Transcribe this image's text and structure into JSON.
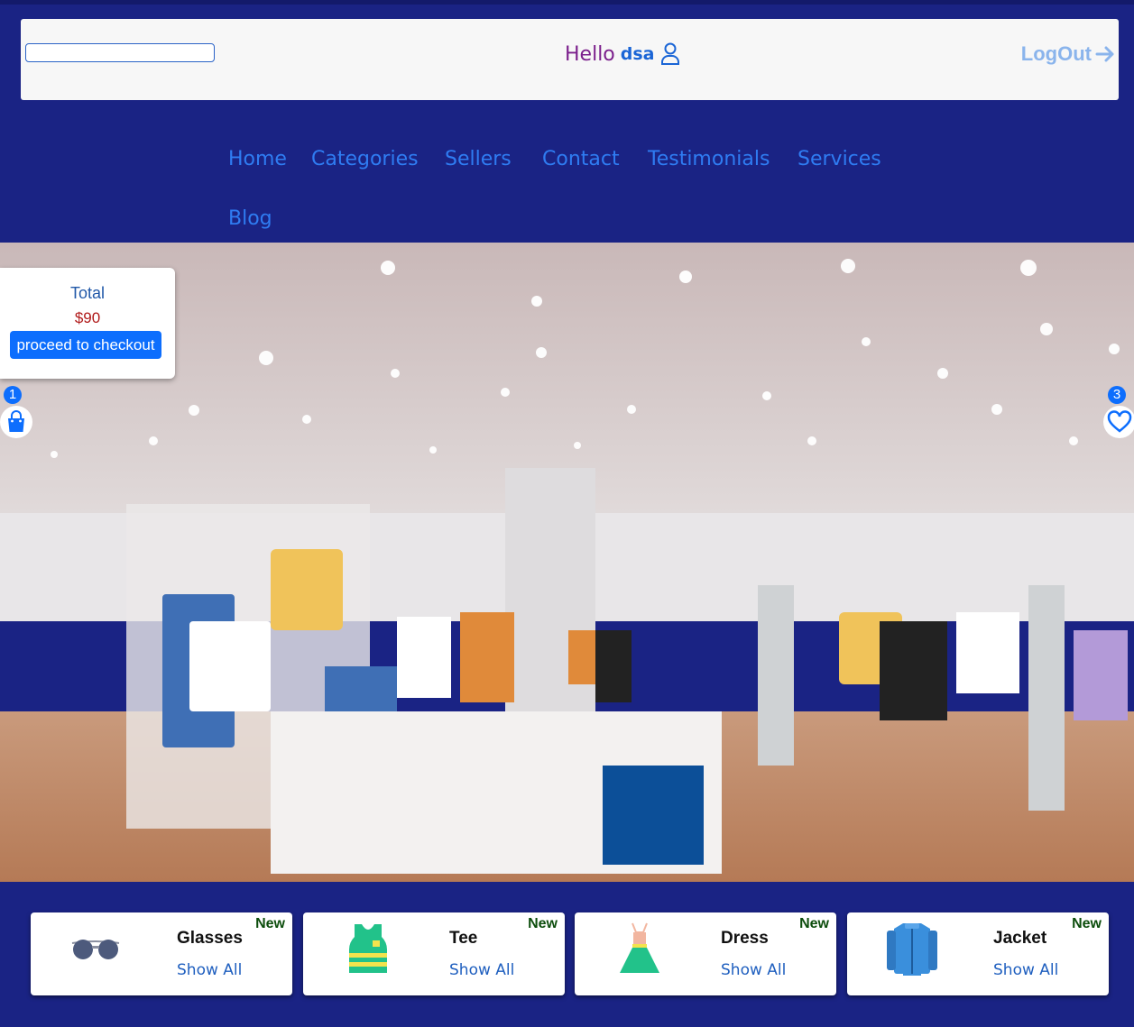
{
  "header": {
    "search": {
      "value": "",
      "placeholder": ""
    },
    "greeting": "Hello",
    "username": "dsa",
    "logout_label": "LogOut"
  },
  "nav": {
    "items": [
      "Home",
      "Categories",
      "Sellers",
      "Contact",
      "Testimonials",
      "Services",
      "Blog"
    ]
  },
  "cart": {
    "total_label": "Total",
    "total_value": "$90",
    "checkout_label": "proceed to checkout",
    "count": "1",
    "icon": "shopping-bag-icon"
  },
  "wishlist": {
    "count": "3",
    "icon": "heart-icon"
  },
  "categories": [
    {
      "name": "Glasses",
      "badge": "New",
      "action": "Show All",
      "icon": "sunglasses-icon"
    },
    {
      "name": "Tee",
      "badge": "New",
      "action": "Show All",
      "icon": "tank-top-icon"
    },
    {
      "name": "Dress",
      "badge": "New",
      "action": "Show All",
      "icon": "dress-icon"
    },
    {
      "name": "Jacket",
      "badge": "New",
      "action": "Show All",
      "icon": "jacket-icon"
    }
  ],
  "colors": {
    "page_bg": "#1a2384",
    "accent": "#0d6efd",
    "nav_link": "#2f7cf2",
    "logout": "#8ab4ec",
    "price": "#b01a1a",
    "badge_text": "#0c4d0c"
  }
}
